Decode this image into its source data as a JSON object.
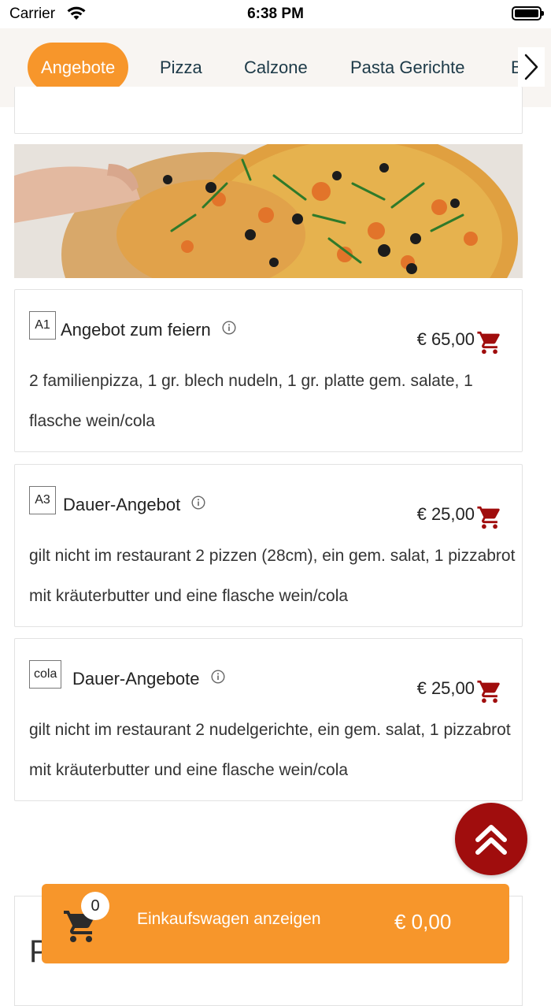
{
  "status_bar": {
    "carrier": "Carrier",
    "time": "6:38 PM"
  },
  "categories": [
    {
      "label": "Angebote",
      "active": true
    },
    {
      "label": "Pizza",
      "active": false
    },
    {
      "label": "Calzone",
      "active": false
    },
    {
      "label": "Pasta Gerichte",
      "active": false
    },
    {
      "label": "B",
      "active": false
    }
  ],
  "hero_image": {
    "alt": "pizza-photo"
  },
  "items": [
    {
      "code": "A1",
      "title": "Angebot zum feiern",
      "price": "€ 65,00",
      "description": "2 familienpizza, 1 gr. blech nudeln, 1 gr. platte gem. salate, 1 flasche wein/cola"
    },
    {
      "code": "A3",
      "title": "Dauer-Angebot",
      "price": "€ 25,00",
      "description": "gilt nicht im restaurant 2 pizzen (28cm), ein gem. salat, 1 pizzabrot mit kräuterbutter und eine flasche wein/cola"
    },
    {
      "code": "cola",
      "title": "Dauer-Angebote",
      "price": "€ 25,00",
      "description": "gilt nicht im restaurant 2 nudelgerichte, ein gem. salat, 1 pizzabrot mit kräuterbutter und eine flasche wein/cola"
    }
  ],
  "next_section": {
    "letter": "P"
  },
  "cart": {
    "count": "0",
    "label": "Einkaufswagen anzeigen",
    "total": "€ 0,00"
  },
  "colors": {
    "accent": "#f7962b",
    "cart_red": "#a00d0d",
    "category_text": "#1d3a48"
  },
  "icons": [
    "wifi-icon",
    "battery-icon",
    "chevron-right-icon",
    "info-icon",
    "cart-icon",
    "double-chevron-up-icon"
  ]
}
